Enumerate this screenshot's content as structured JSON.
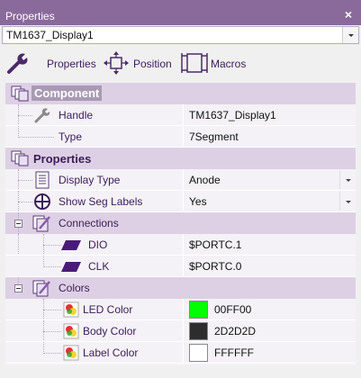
{
  "window": {
    "title": "Properties",
    "close_symbol": "×"
  },
  "component_selector": {
    "value": "TM1637_Display1"
  },
  "toolbar": {
    "properties_label": "Properties",
    "position_label": "Position",
    "macros_label": "Macros"
  },
  "sections": {
    "component": {
      "label": "Component",
      "rows": [
        {
          "name": "Handle",
          "value": "TM1637_Display1",
          "icon": "wrench-icon"
        },
        {
          "name": "Type",
          "value": "7Segment"
        }
      ]
    },
    "properties": {
      "label": "Properties",
      "rows": [
        {
          "name": "Display Type",
          "value": "Anode",
          "icon": "document-icon"
        },
        {
          "name": "Show Seg Labels",
          "value": "Yes",
          "icon": "crosshair-icon"
        }
      ]
    },
    "connections": {
      "label": "Connections",
      "rows": [
        {
          "name": "DIO",
          "value": "$PORTC.1",
          "icon": "pin-icon"
        },
        {
          "name": "CLK",
          "value": "$PORTC.0",
          "icon": "pin-icon"
        }
      ]
    },
    "colors": {
      "label": "Colors",
      "rows": [
        {
          "name": "LED Color",
          "value": "00FF00",
          "swatch": "#00ff00",
          "icon": "palette-icon"
        },
        {
          "name": "Body Color",
          "value": "2D2D2D",
          "swatch": "#2d2d2d",
          "icon": "palette-icon"
        },
        {
          "name": "Label Color",
          "value": "FFFFFF",
          "swatch": "#ffffff",
          "icon": "palette-icon"
        }
      ]
    }
  },
  "colors": {
    "titlebar": "#8a6a9a",
    "category_bg": "#ddd0e4",
    "selected_bg": "#a89ab4",
    "text_accent": "#3c1c5a"
  }
}
